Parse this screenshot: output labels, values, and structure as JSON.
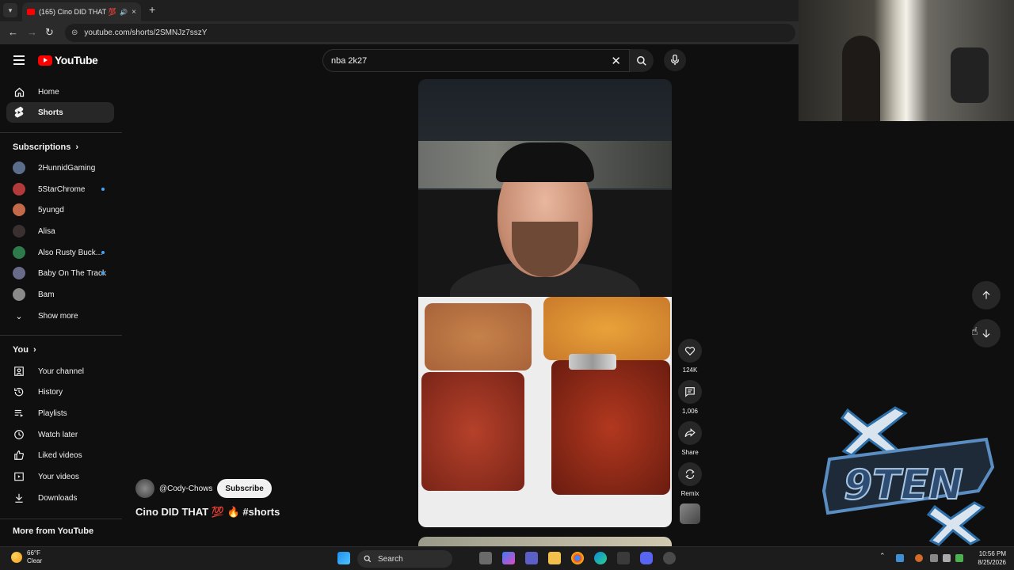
{
  "browser": {
    "tab": {
      "title": "(165) Cino DID THAT 💯🔥",
      "audio_icon": "speaker-icon",
      "close": "×"
    },
    "new_tab": "+",
    "url": "youtube.com/shorts/2SMNJz7sszY"
  },
  "youtube": {
    "logo_text": "YouTube",
    "search": {
      "query": "nba 2k27"
    }
  },
  "sidebar": {
    "main": [
      {
        "label": "Home",
        "icon": "home-icon",
        "active": false
      },
      {
        "label": "Shorts",
        "icon": "shorts-icon",
        "active": true
      }
    ],
    "subscriptions_title": "Subscriptions",
    "subscriptions": [
      {
        "label": "2HunnidGaming",
        "color": "#5a6e8c",
        "live": false
      },
      {
        "label": "5StarChrome",
        "color": "#b23a3a",
        "live": true
      },
      {
        "label": "5yungd",
        "color": "#c46a4a",
        "live": false
      },
      {
        "label": "Alisa",
        "color": "#3a3030",
        "live": false
      },
      {
        "label": "Also Rusty Buck...",
        "color": "#2f7a4a",
        "live": true
      },
      {
        "label": "Baby On The Track",
        "color": "#6a6a8a",
        "live": true
      },
      {
        "label": "Bam",
        "color": "#8a8a8a",
        "live": false
      }
    ],
    "show_more": "Show more",
    "you_title": "You",
    "you_items": [
      {
        "label": "Your channel",
        "icon": "channel-icon"
      },
      {
        "label": "History",
        "icon": "history-icon"
      },
      {
        "label": "Playlists",
        "icon": "playlists-icon"
      },
      {
        "label": "Watch later",
        "icon": "clock-icon"
      },
      {
        "label": "Liked videos",
        "icon": "thumb-up-icon"
      },
      {
        "label": "Your videos",
        "icon": "video-icon"
      },
      {
        "label": "Downloads",
        "icon": "download-icon"
      }
    ],
    "more_title": "More from YouTube"
  },
  "short": {
    "channel": "@Cody-Chows",
    "subscribe": "Subscribe",
    "title": "Cino DID THAT 💯 🔥 #shorts",
    "actions": {
      "like_count": "124K",
      "comment_count": "1,006",
      "share_label": "Share",
      "remix_label": "Remix"
    }
  },
  "taskbar": {
    "weather_temp": "66°F",
    "weather_desc": "Clear",
    "search_label": "Search",
    "time": "10:56 PM",
    "date": "8/25/2026"
  },
  "colors": {
    "background": "#0f0f0f",
    "accent_red": "#ff0000",
    "live_dot": "#3ea6ff"
  }
}
